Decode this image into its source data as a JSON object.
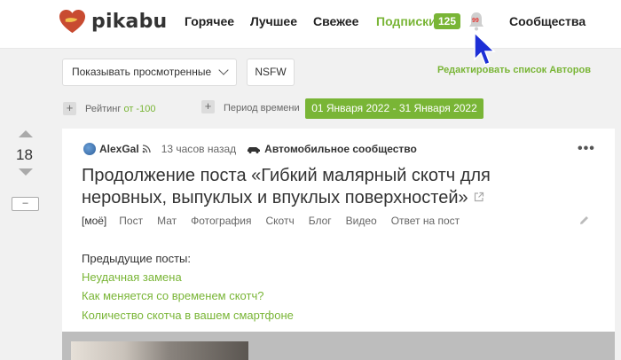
{
  "header": {
    "logo_text": "pikabu",
    "nav": {
      "hot": "Горячее",
      "best": "Лучшее",
      "fresh": "Свежее",
      "subscriptions": "Подписки",
      "subscriptions_count": "125",
      "communities": "Сообщества"
    },
    "notifications_count": "99",
    "accent_color": "#79b536"
  },
  "filters": {
    "show_select": "Показывать просмотренные",
    "nsfw": "NSFW",
    "edit_authors": "Редактировать список Авторов",
    "rating_label": "Рейтинг",
    "rating_value": "от -100",
    "period_label": "Период времени",
    "period_value": "01 Января 2022 - 31 Января 2022"
  },
  "post": {
    "rating": "18",
    "collapse": "–",
    "author": "AlexGal",
    "time": "13 часов назад",
    "community": "Автомобильное сообщество",
    "title": "Продолжение поста «Гибкий малярный скотч для неровных, выпуклых и впуклых поверхностей»",
    "tags": [
      "[моё]",
      "Пост",
      "Мат",
      "Фотография",
      "Скотч",
      "Блог",
      "Видео",
      "Ответ на пост"
    ],
    "previous_label": "Предыдущие посты:",
    "previous_links": [
      "Неудачная замена",
      "Как меняется со временем скотч?",
      "Количество скотча в вашем смартфоне"
    ]
  },
  "icons": [
    "heart-logo-icon",
    "bell-icon",
    "cursor-icon",
    "chevron-down-icon",
    "plus-icon",
    "arrow-up-icon",
    "arrow-down-icon",
    "rss-icon",
    "car-icon",
    "more-dots-icon",
    "external-link-icon",
    "pencil-icon"
  ]
}
